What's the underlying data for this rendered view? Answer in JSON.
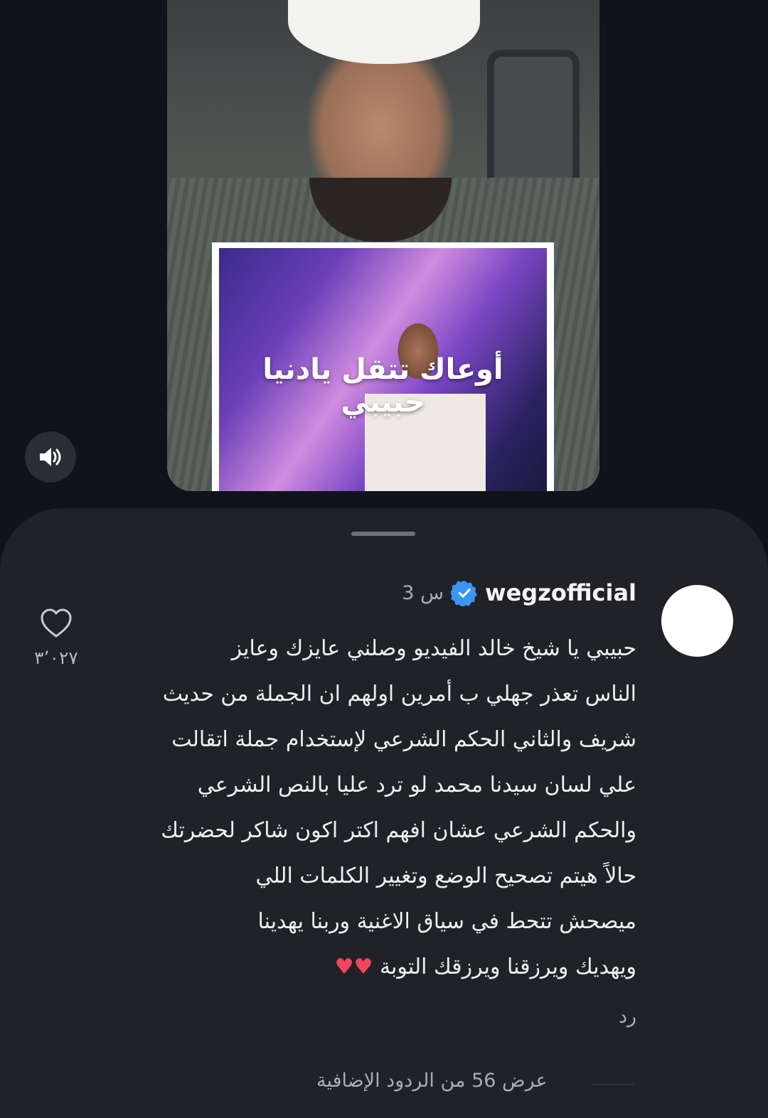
{
  "video": {
    "overlay_caption": "أوعاك تتقل يادنيا حبيبي",
    "mute_icon": "speaker-volume-icon"
  },
  "comment": {
    "username": "wegzofficial",
    "verified_icon": "verified-badge-icon",
    "time_ago": "3 س",
    "lines": [
      "حبيبي يا شيخ خالد الفيديو وصلني عايزك وعايز",
      "الناس تعذر جهلي ب أمرين اولهم ان الجملة من حديث",
      "شريف والثاني الحكم الشرعي لإستخدام جملة اتقالت",
      "علي لسان سيدنا محمد لو ترد عليا بالنص الشرعي",
      "والحكم الشرعي عشان افهم اكتر اكون شاكر لحضرتك",
      "حالاً هيتم تصحيح الوضع وتغيير الكلمات اللي",
      "ميصحش تتحط في سياق الاغنية وربنا يهدينا",
      "ويهديك ويرزقنا ويرزقك التوبة"
    ],
    "emoji": "♥♥",
    "reply_label": "رد",
    "like_icon": "heart-outline-icon",
    "like_count": "٣٬٠٢٧"
  },
  "more_replies_label": "عرض 56 من الردود الإضافية",
  "colors": {
    "sheet_bg": "#202227",
    "page_bg": "#0f131a",
    "verified_blue": "#3897f0",
    "heart_red": "#f2455d"
  }
}
